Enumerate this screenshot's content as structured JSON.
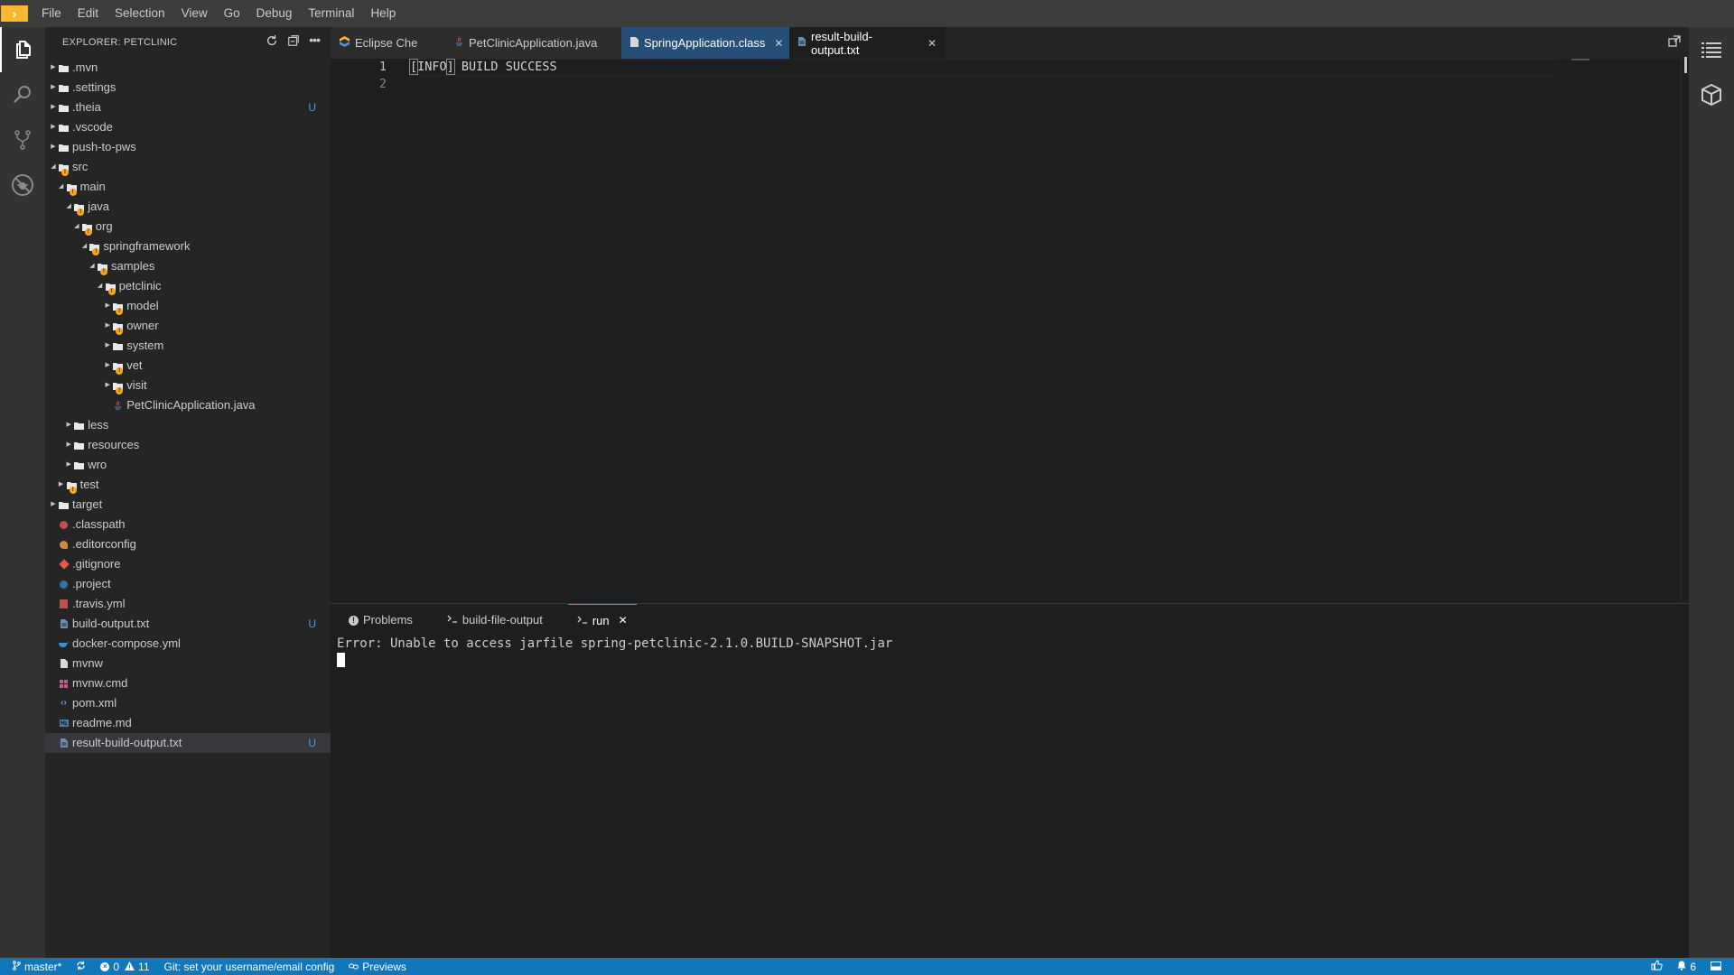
{
  "menubar": {
    "logo_glyph": "›",
    "items": [
      "File",
      "Edit",
      "Selection",
      "View",
      "Go",
      "Debug",
      "Terminal",
      "Help"
    ]
  },
  "activitybar": {
    "icons": [
      "files-icon",
      "search-icon",
      "source-control-icon",
      "debug-icon"
    ]
  },
  "explorer": {
    "title": "EXPLORER: PETCLINIC",
    "items": [
      {
        "label": ".mvn",
        "depth": 0,
        "type": "folder",
        "state": "collapsed"
      },
      {
        "label": ".settings",
        "depth": 0,
        "type": "folder",
        "state": "collapsed"
      },
      {
        "label": ".theia",
        "depth": 0,
        "type": "folder",
        "state": "collapsed",
        "badge": "U"
      },
      {
        "label": ".vscode",
        "depth": 0,
        "type": "folder",
        "state": "collapsed"
      },
      {
        "label": "push-to-pws",
        "depth": 0,
        "type": "folder",
        "state": "collapsed"
      },
      {
        "label": "src",
        "depth": 0,
        "type": "folder",
        "state": "expanded",
        "warn": true
      },
      {
        "label": "main",
        "depth": 1,
        "type": "folder",
        "state": "expanded",
        "warn": true
      },
      {
        "label": "java",
        "depth": 2,
        "type": "folder",
        "state": "expanded",
        "warn": true
      },
      {
        "label": "org",
        "depth": 3,
        "type": "folder",
        "state": "expanded",
        "warn": true
      },
      {
        "label": "springframework",
        "depth": 4,
        "type": "folder",
        "state": "expanded",
        "warn": true
      },
      {
        "label": "samples",
        "depth": 5,
        "type": "folder",
        "state": "expanded",
        "warn": true
      },
      {
        "label": "petclinic",
        "depth": 6,
        "type": "folder",
        "state": "expanded",
        "warn": true
      },
      {
        "label": "model",
        "depth": 7,
        "type": "folder",
        "state": "collapsed",
        "warn": true
      },
      {
        "label": "owner",
        "depth": 7,
        "type": "folder",
        "state": "collapsed",
        "warn": true
      },
      {
        "label": "system",
        "depth": 7,
        "type": "folder",
        "state": "collapsed"
      },
      {
        "label": "vet",
        "depth": 7,
        "type": "folder",
        "state": "collapsed",
        "warn": true
      },
      {
        "label": "visit",
        "depth": 7,
        "type": "folder",
        "state": "collapsed",
        "warn": true
      },
      {
        "label": "PetClinicApplication.java",
        "depth": 7,
        "type": "java"
      },
      {
        "label": "less",
        "depth": 2,
        "type": "folder",
        "state": "collapsed"
      },
      {
        "label": "resources",
        "depth": 2,
        "type": "folder",
        "state": "collapsed"
      },
      {
        "label": "wro",
        "depth": 2,
        "type": "folder",
        "state": "collapsed"
      },
      {
        "label": "test",
        "depth": 1,
        "type": "folder",
        "state": "collapsed",
        "warn": true
      },
      {
        "label": "target",
        "depth": 0,
        "type": "folder",
        "state": "collapsed"
      },
      {
        "label": ".classpath",
        "depth": 0,
        "type": "classpath"
      },
      {
        "label": ".editorconfig",
        "depth": 0,
        "type": "editorconfig"
      },
      {
        "label": ".gitignore",
        "depth": 0,
        "type": "git"
      },
      {
        "label": ".project",
        "depth": 0,
        "type": "project"
      },
      {
        "label": ".travis.yml",
        "depth": 0,
        "type": "travis"
      },
      {
        "label": "build-output.txt",
        "depth": 0,
        "type": "txt",
        "badge": "U"
      },
      {
        "label": "docker-compose.yml",
        "depth": 0,
        "type": "docker"
      },
      {
        "label": "mvnw",
        "depth": 0,
        "type": "file"
      },
      {
        "label": "mvnw.cmd",
        "depth": 0,
        "type": "cmd"
      },
      {
        "label": "pom.xml",
        "depth": 0,
        "type": "xml"
      },
      {
        "label": "readme.md",
        "depth": 0,
        "type": "md"
      },
      {
        "label": "result-build-output.txt",
        "depth": 0,
        "type": "txt",
        "badge": "U",
        "selected": true
      }
    ]
  },
  "tabs": [
    {
      "label": "Eclipse Che",
      "icon": "che-icon",
      "style": "normal",
      "closable": false
    },
    {
      "label": "PetClinicApplication.java",
      "icon": "java-icon",
      "style": "normal",
      "closable": false
    },
    {
      "label": "SpringApplication.class",
      "icon": "class-file-icon",
      "style": "blue",
      "closable": true
    },
    {
      "label": "result-build-output.txt",
      "icon": "txt-file-icon",
      "style": "active",
      "closable": true
    }
  ],
  "editor": {
    "lines": [
      {
        "num": "1",
        "bracket": "[",
        "word": "INFO",
        "bracket_close": "]",
        "rest": " BUILD SUCCESS"
      },
      {
        "num": "2",
        "text": ""
      }
    ]
  },
  "panel": {
    "tabs": [
      {
        "label": "Problems",
        "icon": "problems-icon",
        "active": false
      },
      {
        "label": "build-file-output",
        "icon": "terminal-icon",
        "active": false
      },
      {
        "label": "run",
        "icon": "terminal-icon",
        "active": true,
        "closable": true
      }
    ],
    "terminal_text": "Error: Unable to access jarfile spring-petclinic-2.1.0.BUILD-SNAPSHOT.jar"
  },
  "statusbar": {
    "branch": "master*",
    "errors": "0",
    "warnings": "11",
    "git_message": "Git: set your username/email config",
    "previews": "Previews",
    "notifications": "6"
  },
  "colors": {
    "accent": "#1177bb",
    "warn": "#f5a623",
    "untracked": "#4a9de0"
  }
}
